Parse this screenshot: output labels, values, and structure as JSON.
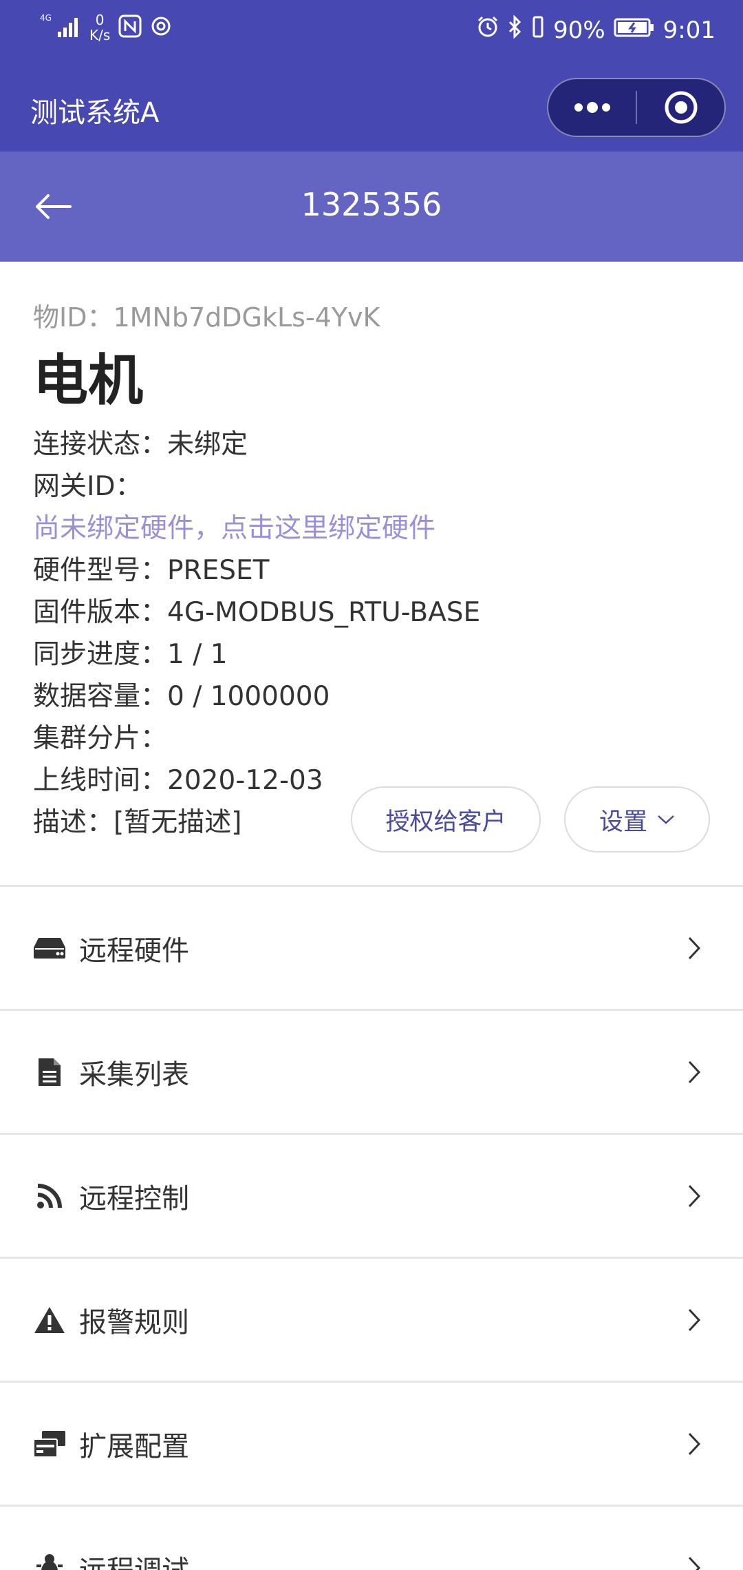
{
  "status_bar": {
    "network": "4G",
    "net_speed_value": "0",
    "net_speed_unit": "K/s",
    "battery_percent": "90%",
    "time": "9:01"
  },
  "app": {
    "title": "测试系统A"
  },
  "header": {
    "title": "1325356"
  },
  "device": {
    "thing_id": "物ID：1MNb7dDGkLs-4YvK",
    "name": "电机",
    "connection_status": "连接状态：未绑定",
    "gateway_id": "网关ID：",
    "bind_hint": "尚未绑定硬件，点击这里绑定硬件",
    "hardware_model": "硬件型号：PRESET",
    "firmware_version": "固件版本：4G-MODBUS_RTU-BASE",
    "sync_progress": "同步进度：1 / 1",
    "data_capacity": "数据容量：0 / 1000000",
    "cluster_shard": "集群分片：",
    "online_time": "上线时间：2020-12-03",
    "description": "描述：[暂无描述]"
  },
  "actions": {
    "authorize_label": "授权给客户",
    "settings_label": "设置"
  },
  "menu": {
    "items": [
      {
        "label": "远程硬件",
        "icon": "hard-drive-icon"
      },
      {
        "label": "采集列表",
        "icon": "document-icon"
      },
      {
        "label": "远程控制",
        "icon": "rss-icon"
      },
      {
        "label": "报警规则",
        "icon": "warning-icon"
      },
      {
        "label": "扩展配置",
        "icon": "cards-icon"
      },
      {
        "label": "远程调试",
        "icon": "bug-icon"
      }
    ]
  },
  "colors": {
    "primary_dark": "#4848b3",
    "primary_header": "#6464c3",
    "link": "#9b8fd6"
  }
}
